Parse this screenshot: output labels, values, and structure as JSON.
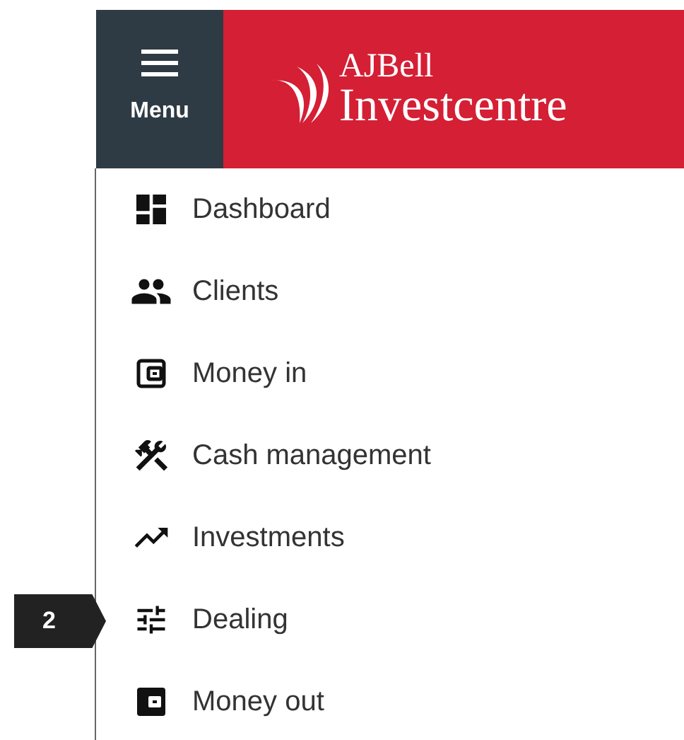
{
  "header": {
    "menu_label": "Menu",
    "logo_top": "AJBell",
    "logo_bottom": "Investcentre"
  },
  "menu_items": [
    {
      "label": "Dashboard"
    },
    {
      "label": "Clients"
    },
    {
      "label": "Money in"
    },
    {
      "label": "Cash management"
    },
    {
      "label": "Investments"
    },
    {
      "label": "Dealing",
      "callout": "2"
    },
    {
      "label": "Money out"
    }
  ]
}
